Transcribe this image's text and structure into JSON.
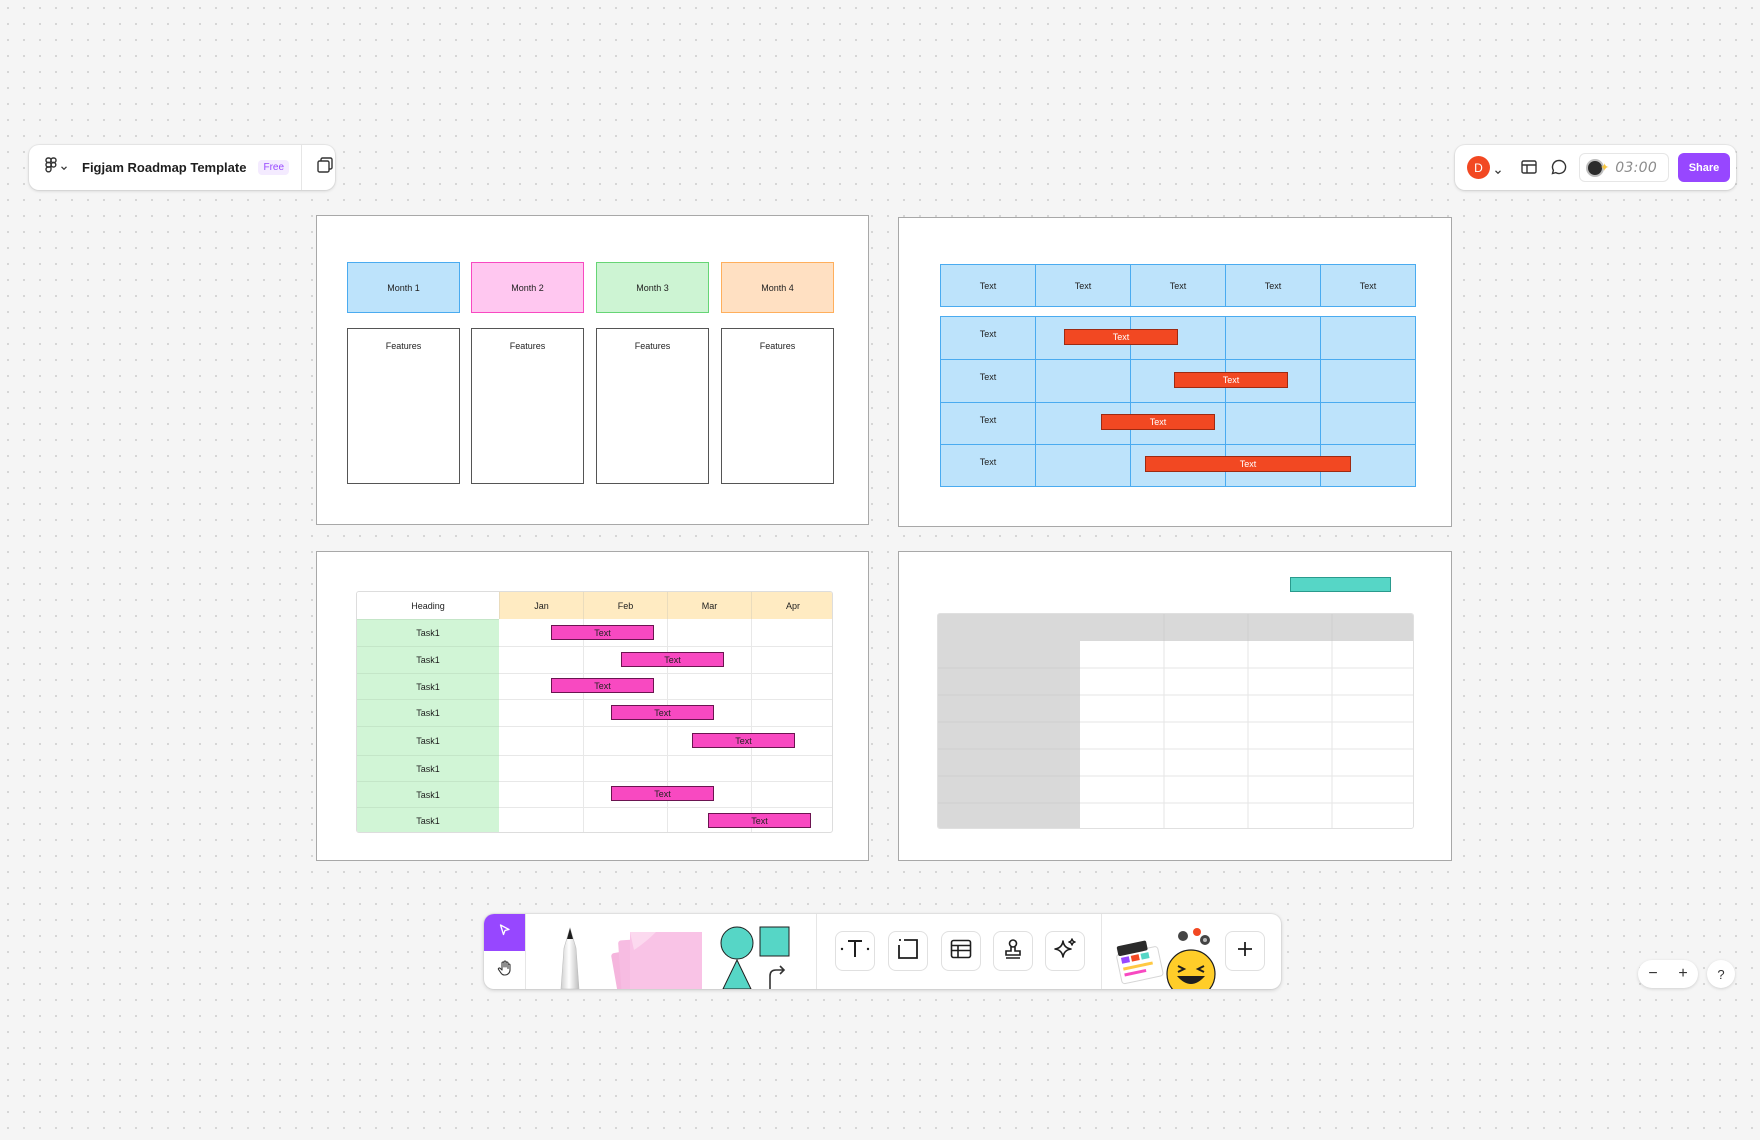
{
  "header": {
    "file_title": "Figjam Roadmap Template",
    "plan_badge": "Free"
  },
  "collab": {
    "avatar_initial": "D",
    "timer": "03:00",
    "share_label": "Share"
  },
  "roadmap": {
    "months": [
      "Month 1",
      "Month 2",
      "Month 3",
      "Month 4"
    ],
    "feature_label": "Features",
    "colors": {
      "month1": "#bde3fb",
      "month2": "#ffc7f0",
      "month3": "#cdf4d3",
      "month4": "#ffe0c2"
    }
  },
  "timeline": {
    "header_cells": [
      "Text",
      "Text",
      "Text",
      "Text",
      "Text"
    ],
    "row_labels": [
      "Text",
      "Text",
      "Text",
      "Text"
    ],
    "bar_label": "Text",
    "bar_color": "#f24822",
    "cell_color": "#bde3fb"
  },
  "gantt": {
    "heading": "Heading",
    "months": [
      "Jan",
      "Feb",
      "Mar",
      "Apr"
    ],
    "tasks": [
      "Task1",
      "Task1",
      "Task1",
      "Task1",
      "Task1",
      "Task1",
      "Task1",
      "Task1"
    ],
    "bar_label": "Text",
    "bar_color": "#f849c1"
  },
  "table_frame": {
    "accent_color": "#56d6c6"
  },
  "zoom": {
    "minus": "−",
    "plus": "+",
    "help": "?"
  }
}
